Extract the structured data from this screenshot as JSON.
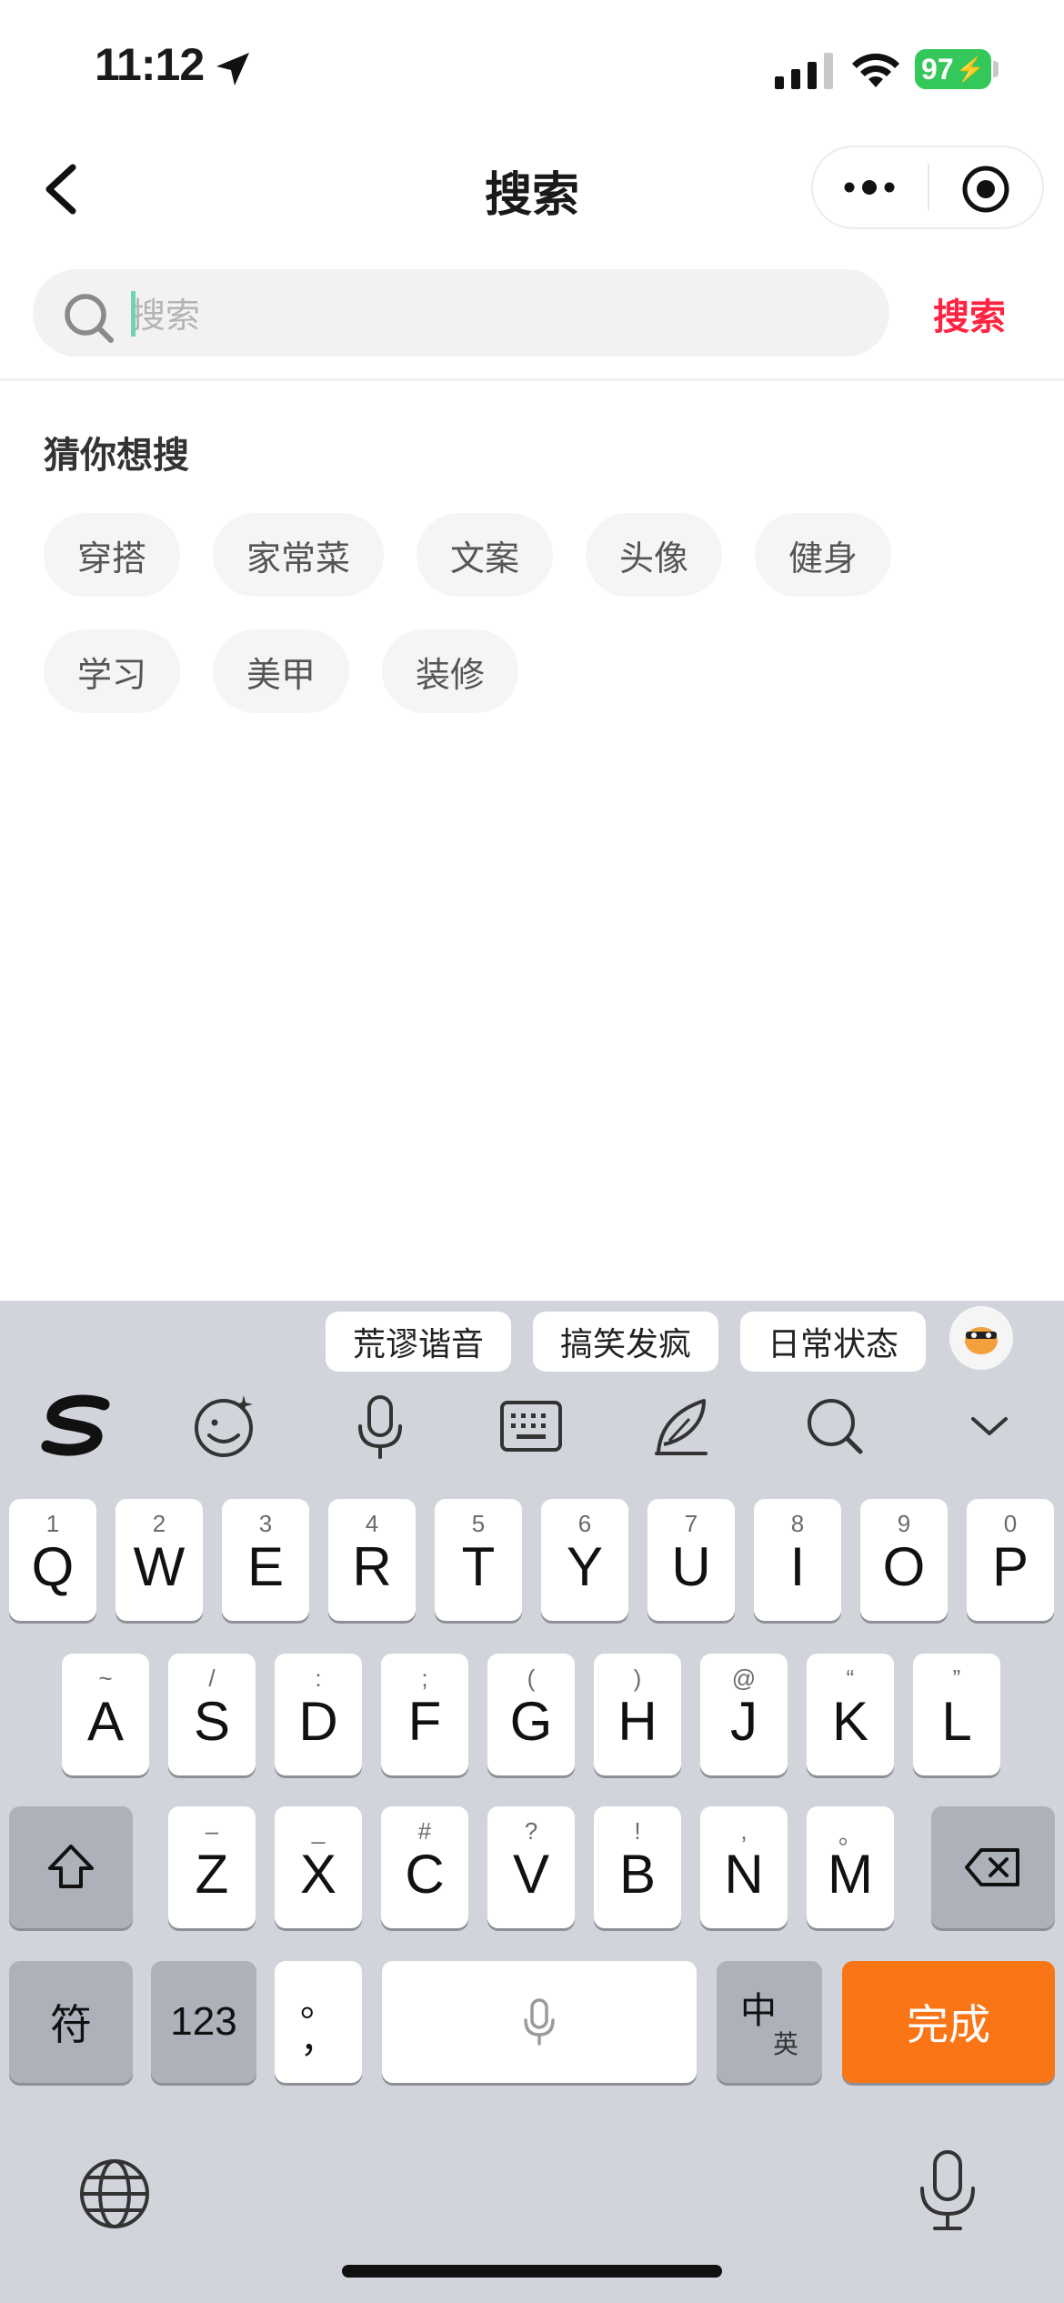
{
  "status_bar": {
    "time": "11:12",
    "battery": "97"
  },
  "nav": {
    "title": "搜索"
  },
  "search": {
    "placeholder": "搜索",
    "button_label": "搜索"
  },
  "suggestions": {
    "title": "猜你想搜",
    "items": [
      "穿搭",
      "家常菜",
      "文案",
      "头像",
      "健身",
      "学习",
      "美甲",
      "装修"
    ]
  },
  "keyboard": {
    "candidates": [
      "荒谬谐音",
      "搞笑发疯",
      "日常状态"
    ],
    "row1": [
      {
        "key": "Q",
        "hint": "1"
      },
      {
        "key": "W",
        "hint": "2"
      },
      {
        "key": "E",
        "hint": "3"
      },
      {
        "key": "R",
        "hint": "4"
      },
      {
        "key": "T",
        "hint": "5"
      },
      {
        "key": "Y",
        "hint": "6"
      },
      {
        "key": "U",
        "hint": "7"
      },
      {
        "key": "I",
        "hint": "8"
      },
      {
        "key": "O",
        "hint": "9"
      },
      {
        "key": "P",
        "hint": "0"
      }
    ],
    "row2": [
      {
        "key": "A",
        "hint": "~"
      },
      {
        "key": "S",
        "hint": "/"
      },
      {
        "key": "D",
        "hint": ":"
      },
      {
        "key": "F",
        "hint": ";"
      },
      {
        "key": "G",
        "hint": "("
      },
      {
        "key": "H",
        "hint": ")"
      },
      {
        "key": "J",
        "hint": "@"
      },
      {
        "key": "K",
        "hint": "“"
      },
      {
        "key": "L",
        "hint": "”"
      }
    ],
    "row3": [
      {
        "key": "Z",
        "hint": "–"
      },
      {
        "key": "X",
        "hint": "_"
      },
      {
        "key": "C",
        "hint": "#"
      },
      {
        "key": "V",
        "hint": "?"
      },
      {
        "key": "B",
        "hint": "!"
      },
      {
        "key": "N",
        "hint": ","
      },
      {
        "key": "M",
        "hint": "。"
      }
    ],
    "symbol_key": "符",
    "number_key": "123",
    "punct_top": "。",
    "punct_bottom": "，",
    "lang_zh": "中",
    "lang_en": "英",
    "done_key": "完成"
  },
  "colors": {
    "accent": "#ff2442",
    "done": "#f97516",
    "battery": "#34c759"
  }
}
